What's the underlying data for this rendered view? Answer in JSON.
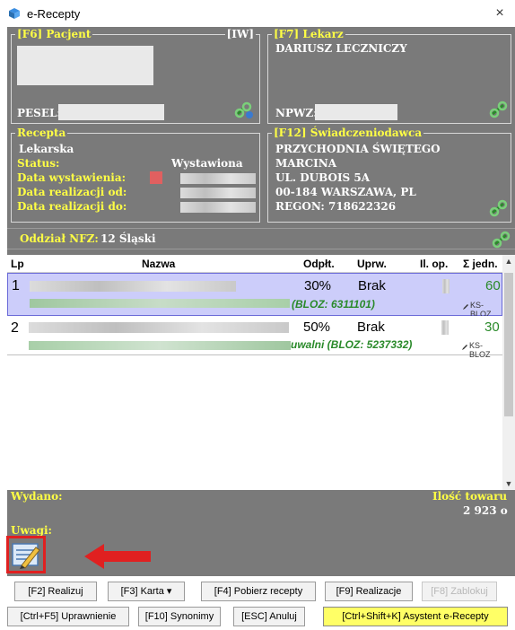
{
  "window": {
    "title": "e-Recepty",
    "close": "×"
  },
  "patient": {
    "legend": "[F6] Pacjent",
    "right_tag": "[IW]",
    "pesel_label": "PESEL:"
  },
  "doctor": {
    "legend": "[F7] Lekarz",
    "name": "DARIUSZ LECZNICZY",
    "npwz_label": "NPWZ:"
  },
  "prescription": {
    "legend": "Recepta",
    "type": "Lekarska",
    "status_label": "Status:",
    "status_value": "Wystawiona",
    "issue_date_label": "Data wystawienia:",
    "realization_from_label": "Data realizacji od:",
    "realization_to_label": "Data realizacji do:"
  },
  "provider": {
    "legend": "[F12] Świadczeniodawca",
    "lines": [
      "PRZYCHODNIA ŚWIĘTEGO",
      "MARCINA",
      "UL. DUBOIS 5A",
      "00-184 WARSZAWA, PL",
      "REGON: 718622326"
    ]
  },
  "nfz": {
    "label": "Oddział NFZ:",
    "value": "12 Śląski"
  },
  "table": {
    "headers": [
      "Lp",
      "Nazwa",
      "Odpłt.",
      "Uprw.",
      "Il. op.",
      "Σ jedn."
    ],
    "rows": [
      {
        "lp": "1",
        "odplt": "30%",
        "uprw": "Brak",
        "sum": "60",
        "bloz": "(BLOZ: 6311101)",
        "ks": "KS-BLOZ"
      },
      {
        "lp": "2",
        "odplt": "50%",
        "uprw": "Brak",
        "sum": "30",
        "bloz": "uwalni (BLOZ: 5237332)",
        "ks": "KS-BLOZ"
      }
    ]
  },
  "summary": {
    "issued_label": "Wydano:",
    "quantity_label": "Ilość towaru",
    "quantity_value": "2 923 o",
    "notes_label": "Uwagi:"
  },
  "buttons_row1": [
    {
      "label": "[F2] Realizuj"
    },
    {
      "label": "[F3] Karta ▾"
    },
    {
      "label": "[F4] Pobierz recepty"
    },
    {
      "label": "[F9] Realizacje"
    },
    {
      "label": "[F8] Zablokuj"
    }
  ],
  "buttons_row2": [
    {
      "label": "[Ctrl+F5] Uprawnienie"
    },
    {
      "label": "[F10] Synonimy"
    },
    {
      "label": "[ESC] Anuluj"
    },
    {
      "label": "[Ctrl+Shift+K] Asystent e-Recepty"
    }
  ],
  "colors": {
    "frame": "#7a7a7a",
    "legend": "#ffff44",
    "selected_row": "#cccdfa",
    "highlight_button": "#ffff66",
    "annotation": "#e02020"
  },
  "icons": [
    "app-icon",
    "link-chain-icon",
    "notes-edit-icon",
    "red-arrow"
  ]
}
